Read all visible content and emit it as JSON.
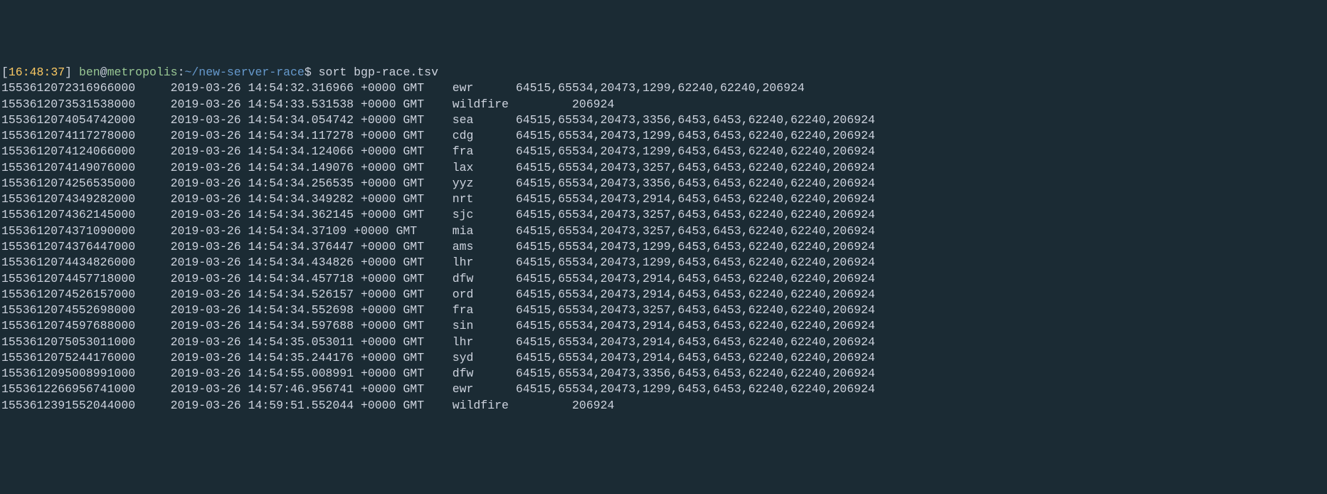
{
  "prompt": {
    "time": "16:48:37",
    "user": "ben",
    "host": "metropolis",
    "path": "~/new-server-race",
    "symbol": "$"
  },
  "command": "sort bgp-race.tsv",
  "rows": [
    {
      "ts": "1553612072316966000",
      "dt": "2019-03-26 14:54:32.316966 +0000 GMT",
      "loc": "ewr",
      "as": "64515,65534,20473,1299,62240,62240,206924"
    },
    {
      "ts": "1553612073531538000",
      "dt": "2019-03-26 14:54:33.531538 +0000 GMT",
      "loc": "wildfire",
      "as": "206924",
      "wildfire": true
    },
    {
      "ts": "1553612074054742000",
      "dt": "2019-03-26 14:54:34.054742 +0000 GMT",
      "loc": "sea",
      "as": "64515,65534,20473,3356,6453,6453,62240,62240,206924"
    },
    {
      "ts": "1553612074117278000",
      "dt": "2019-03-26 14:54:34.117278 +0000 GMT",
      "loc": "cdg",
      "as": "64515,65534,20473,1299,6453,6453,62240,62240,206924"
    },
    {
      "ts": "1553612074124066000",
      "dt": "2019-03-26 14:54:34.124066 +0000 GMT",
      "loc": "fra",
      "as": "64515,65534,20473,1299,6453,6453,62240,62240,206924"
    },
    {
      "ts": "1553612074149076000",
      "dt": "2019-03-26 14:54:34.149076 +0000 GMT",
      "loc": "lax",
      "as": "64515,65534,20473,3257,6453,6453,62240,62240,206924"
    },
    {
      "ts": "1553612074256535000",
      "dt": "2019-03-26 14:54:34.256535 +0000 GMT",
      "loc": "yyz",
      "as": "64515,65534,20473,3356,6453,6453,62240,62240,206924"
    },
    {
      "ts": "1553612074349282000",
      "dt": "2019-03-26 14:54:34.349282 +0000 GMT",
      "loc": "nrt",
      "as": "64515,65534,20473,2914,6453,6453,62240,62240,206924"
    },
    {
      "ts": "1553612074362145000",
      "dt": "2019-03-26 14:54:34.362145 +0000 GMT",
      "loc": "sjc",
      "as": "64515,65534,20473,3257,6453,6453,62240,62240,206924"
    },
    {
      "ts": "1553612074371090000",
      "dt": "2019-03-26 14:54:34.37109 +0000 GMT",
      "loc": "mia",
      "as": "64515,65534,20473,3257,6453,6453,62240,62240,206924"
    },
    {
      "ts": "1553612074376447000",
      "dt": "2019-03-26 14:54:34.376447 +0000 GMT",
      "loc": "ams",
      "as": "64515,65534,20473,1299,6453,6453,62240,62240,206924"
    },
    {
      "ts": "1553612074434826000",
      "dt": "2019-03-26 14:54:34.434826 +0000 GMT",
      "loc": "lhr",
      "as": "64515,65534,20473,1299,6453,6453,62240,62240,206924"
    },
    {
      "ts": "1553612074457718000",
      "dt": "2019-03-26 14:54:34.457718 +0000 GMT",
      "loc": "dfw",
      "as": "64515,65534,20473,2914,6453,6453,62240,62240,206924"
    },
    {
      "ts": "1553612074526157000",
      "dt": "2019-03-26 14:54:34.526157 +0000 GMT",
      "loc": "ord",
      "as": "64515,65534,20473,2914,6453,6453,62240,62240,206924"
    },
    {
      "ts": "1553612074552698000",
      "dt": "2019-03-26 14:54:34.552698 +0000 GMT",
      "loc": "fra",
      "as": "64515,65534,20473,3257,6453,6453,62240,62240,206924"
    },
    {
      "ts": "1553612074597688000",
      "dt": "2019-03-26 14:54:34.597688 +0000 GMT",
      "loc": "sin",
      "as": "64515,65534,20473,2914,6453,6453,62240,62240,206924"
    },
    {
      "ts": "1553612075053011000",
      "dt": "2019-03-26 14:54:35.053011 +0000 GMT",
      "loc": "lhr",
      "as": "64515,65534,20473,2914,6453,6453,62240,62240,206924"
    },
    {
      "ts": "1553612075244176000",
      "dt": "2019-03-26 14:54:35.244176 +0000 GMT",
      "loc": "syd",
      "as": "64515,65534,20473,2914,6453,6453,62240,62240,206924"
    },
    {
      "ts": "1553612095008991000",
      "dt": "2019-03-26 14:54:55.008991 +0000 GMT",
      "loc": "dfw",
      "as": "64515,65534,20473,3356,6453,6453,62240,62240,206924"
    },
    {
      "ts": "1553612266956741000",
      "dt": "2019-03-26 14:57:46.956741 +0000 GMT",
      "loc": "ewr",
      "as": "64515,65534,20473,1299,6453,6453,62240,62240,206924"
    },
    {
      "ts": "1553612391552044000",
      "dt": "2019-03-26 14:59:51.552044 +0000 GMT",
      "loc": "wildfire",
      "as": "206924",
      "wildfire": true
    }
  ]
}
